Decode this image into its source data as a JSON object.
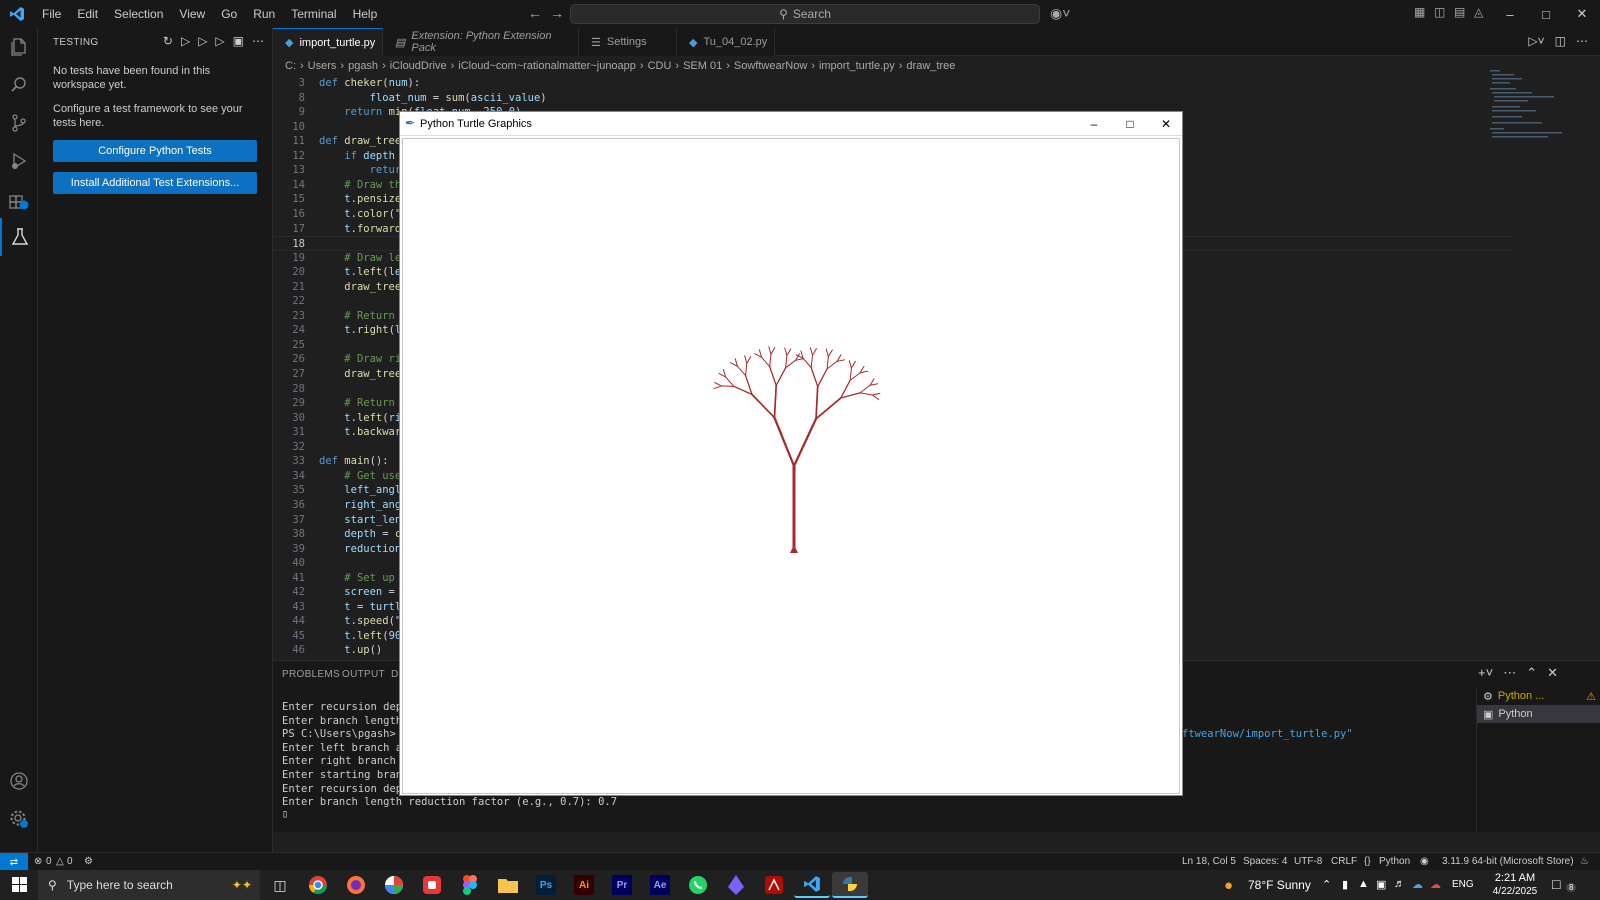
{
  "menu": [
    "File",
    "Edit",
    "Selection",
    "View",
    "Go",
    "Run",
    "Terminal",
    "Help"
  ],
  "search": {
    "label": "Search"
  },
  "sidebar": {
    "header": "TESTING",
    "message1": "No tests have been found in this workspace yet.",
    "message2": "Configure a test framework to see your tests here.",
    "btn_configure": "Configure Python Tests",
    "btn_install": "Install Additional Test Extensions..."
  },
  "tabs": [
    {
      "label": "import_turtle.py"
    },
    {
      "label": "Extension: Python Extension Pack"
    },
    {
      "label": "Settings"
    },
    {
      "label": "Tu_04_02.py"
    }
  ],
  "breadcrumb": [
    "C:",
    "Users",
    "pgash",
    "iCloudDrive",
    "iCloud~com~rationalmatter~junoapp",
    "CDU",
    "SEM 01",
    "SowftwearNow",
    "import_turtle.py",
    "draw_tree"
  ],
  "code": [
    {
      "n": "3",
      "html": "<span class='kw'>def</span> <span class='fn'>cheker</span>(<span class='var'>num</span>):"
    },
    {
      "n": "8",
      "html": "        <span class='var'>float_num</span> = <span class='fn'>sum</span>(<span class='var'>ascii_value</span>)"
    },
    {
      "n": "9",
      "html": "    <span class='kw'>return</span> <span class='fn'>min</span>(<span class='var'>float_num</span>, <span class='var'>250</span>.<span class='var'>0</span>)"
    },
    {
      "n": "10",
      "html": ""
    },
    {
      "n": "11",
      "html": "<span class='kw'>def</span> <span class='fn'>draw_tree</span>("
    },
    {
      "n": "12",
      "html": "    <span class='kw'>if</span> <span class='var'>depth</span> "
    },
    {
      "n": "13",
      "html": "        <span class='kw'>return</span>"
    },
    {
      "n": "14",
      "html": "    <span class='cm'># Draw the</span>"
    },
    {
      "n": "15",
      "html": "    <span class='var'>t</span>.<span class='fn'>pensize</span>("
    },
    {
      "n": "16",
      "html": "    <span class='var'>t</span>.<span class='fn'>color</span>(\""
    },
    {
      "n": "17",
      "html": "    <span class='var'>t</span>.<span class='fn'>forward</span>("
    },
    {
      "n": "18",
      "html": ""
    },
    {
      "n": "19",
      "html": "    <span class='cm'># Draw le</span>"
    },
    {
      "n": "20",
      "html": "    <span class='var'>t</span>.<span class='fn'>left</span>(<span class='var'>lef</span>"
    },
    {
      "n": "21",
      "html": "    <span class='fn'>draw_tree</span>("
    },
    {
      "n": "22",
      "html": ""
    },
    {
      "n": "23",
      "html": "    <span class='cm'># Return</span>"
    },
    {
      "n": "24",
      "html": "    <span class='var'>t</span>.<span class='fn'>right</span>(<span class='var'>le</span>"
    },
    {
      "n": "25",
      "html": ""
    },
    {
      "n": "26",
      "html": "    <span class='cm'># Draw ri</span>"
    },
    {
      "n": "27",
      "html": "    <span class='fn'>draw_tree</span>("
    },
    {
      "n": "28",
      "html": ""
    },
    {
      "n": "29",
      "html": "    <span class='cm'># Return</span>"
    },
    {
      "n": "30",
      "html": "    <span class='var'>t</span>.<span class='fn'>left</span>(<span class='var'>rig</span>"
    },
    {
      "n": "31",
      "html": "    <span class='var'>t</span>.<span class='fn'>backward</span>"
    },
    {
      "n": "32",
      "html": ""
    },
    {
      "n": "33",
      "html": "<span class='kw'>def</span> <span class='fn'>main</span>():"
    },
    {
      "n": "34",
      "html": "    <span class='cm'># Get user</span>"
    },
    {
      "n": "35",
      "html": "    <span class='var'>left_angle</span>"
    },
    {
      "n": "36",
      "html": "    <span class='var'>right_angl</span>"
    },
    {
      "n": "37",
      "html": "    <span class='var'>start_leng</span>"
    },
    {
      "n": "38",
      "html": "    <span class='var'>depth</span> = <span class='fn'>ch</span>"
    },
    {
      "n": "39",
      "html": "    <span class='var'>reduction_</span>"
    },
    {
      "n": "40",
      "html": ""
    },
    {
      "n": "41",
      "html": "    <span class='cm'># Set up t</span>"
    },
    {
      "n": "42",
      "html": "    <span class='var'>screen</span> = <span class='var'>t</span>"
    },
    {
      "n": "43",
      "html": "    <span class='var'>t</span> = <span class='var'>turtl</span>"
    },
    {
      "n": "44",
      "html": "    <span class='var'>t</span>.<span class='fn'>speed</span>(\""
    },
    {
      "n": "45",
      "html": "    <span class='var'>t</span>.<span class='fn'>left</span>(<span class='var'>90</span>"
    },
    {
      "n": "46",
      "html": "    <span class='var'>t</span>.<span class='fn'>up</span>()"
    }
  ],
  "panel": {
    "tab_problems": "PROBLEMS",
    "tab_output": "OUTPUT",
    "tab_debug": "D",
    "terminal": [
      "Enter recursion depth",
      "Enter branch length r",
      "PS C:\\Users\\pgash> &",
      "Enter left branch ang",
      "Enter right branch an",
      "Enter starting branch",
      "Enter recursion depth",
      "Enter branch length reduction factor (e.g., 0.7): 0.7"
    ],
    "terminal_path_tail": "ftwearNow/import_turtle.py\"",
    "term_list": [
      "Python ...",
      "Python"
    ]
  },
  "status": {
    "errors": "0",
    "warnings": "0",
    "position": "Ln 18, Col 5",
    "spaces": "Spaces: 4",
    "encoding": "UTF-8",
    "eol": "CRLF",
    "language": "Python",
    "interpreter": "3.11.9 64-bit (Microsoft Store)"
  },
  "turtle_window": {
    "title": "Python Turtle Graphics"
  },
  "taskbar": {
    "search_placeholder": "Type here to search",
    "weather": "78°F  Sunny",
    "lang": "ENG",
    "time": "2:21 AM",
    "date": "4/22/2025",
    "notif_count": "8"
  },
  "colors": {
    "accent": "#0078d4",
    "tree": "#a52a2a",
    "button": "#0e70c0"
  }
}
